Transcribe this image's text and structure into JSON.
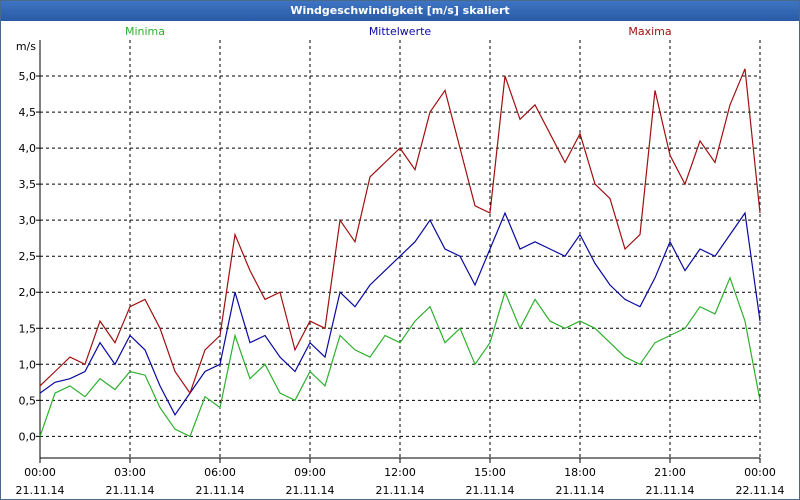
{
  "window": {
    "title": "Windgeschwindigkeit [m/s] skaliert"
  },
  "colors": {
    "minima": "#2db02d",
    "mittelwerte": "#0a0aa0",
    "maxima": "#a01010",
    "grid": "#000000",
    "titlebar": "#2f63b3"
  },
  "chart_data": {
    "type": "line",
    "title": "Windgeschwindigkeit [m/s] skaliert",
    "ylabel": "m/s",
    "xlabel": "",
    "ylim": [
      -0.3,
      5.5
    ],
    "yticks": [
      "0,0",
      "0,5",
      "1,0",
      "1,5",
      "2,0",
      "2,5",
      "3,0",
      "3,5",
      "4,0",
      "4,5",
      "5,0"
    ],
    "xlim": [
      0,
      24
    ],
    "xticks": [
      {
        "time": "00:00",
        "date": "21.11.14"
      },
      {
        "time": "03:00",
        "date": "21.11.14"
      },
      {
        "time": "06:00",
        "date": "21.11.14"
      },
      {
        "time": "09:00",
        "date": "21.11.14"
      },
      {
        "time": "12:00",
        "date": "21.11.14"
      },
      {
        "time": "15:00",
        "date": "21.11.14"
      },
      {
        "time": "18:00",
        "date": "21.11.14"
      },
      {
        "time": "21:00",
        "date": "21.11.14"
      },
      {
        "time": "00:00",
        "date": "22.11.14"
      }
    ],
    "grid": true,
    "legend_position": "top",
    "series": [
      {
        "name": "Minima",
        "x": [
          0,
          0.5,
          1,
          1.5,
          2,
          2.5,
          3,
          3.5,
          4,
          4.5,
          5,
          5.5,
          6,
          6.5,
          7,
          7.5,
          8,
          8.5,
          9,
          9.5,
          10,
          10.5,
          11,
          11.5,
          12,
          12.5,
          13,
          13.5,
          14,
          14.5,
          15,
          15.5,
          16,
          16.5,
          17,
          17.5,
          18,
          18.5,
          19,
          19.5,
          20,
          20.5,
          21,
          21.5,
          22,
          22.5,
          23,
          23.5,
          24
        ],
        "values": [
          0.0,
          0.6,
          0.7,
          0.55,
          0.8,
          0.65,
          0.9,
          0.85,
          0.4,
          0.1,
          0.0,
          0.55,
          0.4,
          1.4,
          0.8,
          1.0,
          0.6,
          0.5,
          0.9,
          0.7,
          1.4,
          1.2,
          1.1,
          1.4,
          1.3,
          1.6,
          1.8,
          1.3,
          1.5,
          1.0,
          1.3,
          2.0,
          1.5,
          1.9,
          1.6,
          1.5,
          1.6,
          1.5,
          1.3,
          1.1,
          1.0,
          1.3,
          1.4,
          1.5,
          1.8,
          1.7,
          2.2,
          1.6,
          0.5
        ]
      },
      {
        "name": "Mittelwerte",
        "x": [
          0,
          0.5,
          1,
          1.5,
          2,
          2.5,
          3,
          3.5,
          4,
          4.5,
          5,
          5.5,
          6,
          6.5,
          7,
          7.5,
          8,
          8.5,
          9,
          9.5,
          10,
          10.5,
          11,
          11.5,
          12,
          12.5,
          13,
          13.5,
          14,
          14.5,
          15,
          15.5,
          16,
          16.5,
          17,
          17.5,
          18,
          18.5,
          19,
          19.5,
          20,
          20.5,
          21,
          21.5,
          22,
          22.5,
          23,
          23.5,
          24
        ],
        "values": [
          0.6,
          0.75,
          0.8,
          0.9,
          1.3,
          1.0,
          1.4,
          1.2,
          0.7,
          0.3,
          0.6,
          0.9,
          1.0,
          2.0,
          1.3,
          1.4,
          1.1,
          0.9,
          1.3,
          1.1,
          2.0,
          1.8,
          2.1,
          2.3,
          2.5,
          2.7,
          3.0,
          2.6,
          2.5,
          2.1,
          2.6,
          3.1,
          2.6,
          2.7,
          2.6,
          2.5,
          2.8,
          2.4,
          2.1,
          1.9,
          1.8,
          2.2,
          2.7,
          2.3,
          2.6,
          2.5,
          2.8,
          3.1,
          1.6
        ]
      },
      {
        "name": "Maxima",
        "x": [
          0,
          0.5,
          1,
          1.5,
          2,
          2.5,
          3,
          3.5,
          4,
          4.5,
          5,
          5.5,
          6,
          6.5,
          7,
          7.5,
          8,
          8.5,
          9,
          9.5,
          10,
          10.5,
          11,
          11.5,
          12,
          12.5,
          13,
          13.5,
          14,
          14.5,
          15,
          15.5,
          16,
          16.5,
          17,
          17.5,
          18,
          18.5,
          19,
          19.5,
          20,
          20.5,
          21,
          21.5,
          22,
          22.5,
          23,
          23.5,
          24
        ],
        "values": [
          0.7,
          0.9,
          1.1,
          1.0,
          1.6,
          1.3,
          1.8,
          1.9,
          1.5,
          0.9,
          0.6,
          1.2,
          1.4,
          2.8,
          2.3,
          1.9,
          2.0,
          1.2,
          1.6,
          1.5,
          3.0,
          2.7,
          3.6,
          3.8,
          4.0,
          3.7,
          4.5,
          4.8,
          4.0,
          3.2,
          3.1,
          5.0,
          4.4,
          4.6,
          4.2,
          3.8,
          4.2,
          3.5,
          3.3,
          2.6,
          2.8,
          4.8,
          3.9,
          3.5,
          4.1,
          3.8,
          4.6,
          5.1,
          3.1
        ]
      }
    ]
  }
}
